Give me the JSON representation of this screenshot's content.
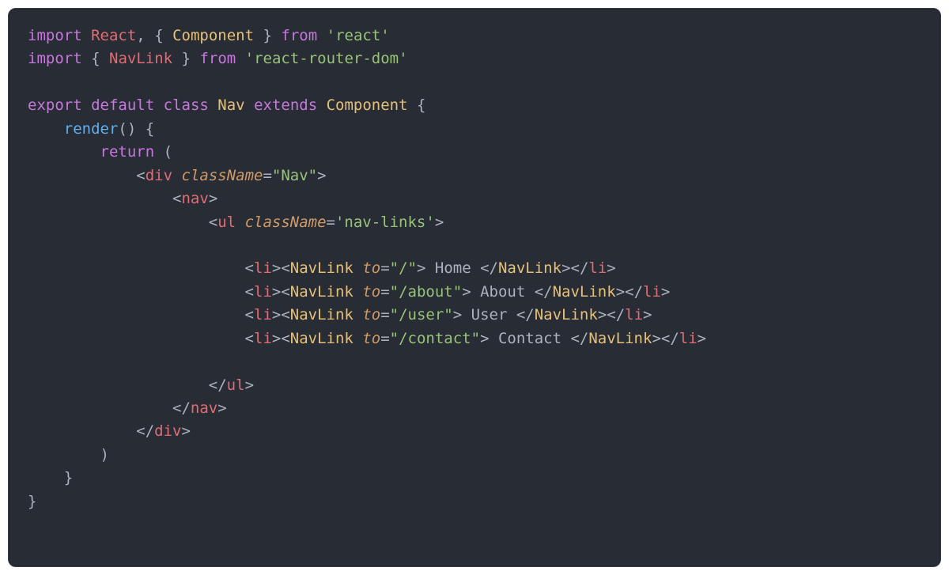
{
  "code": {
    "line1": {
      "import": "import",
      "react": "React",
      "comma": ",",
      "lbrace": "{",
      "component": "Component",
      "rbrace": "}",
      "from": "from",
      "pkg": "'react'"
    },
    "line2": {
      "import": "import",
      "lbrace": "{",
      "navlink": "NavLink",
      "rbrace": "}",
      "from": "from",
      "pkg": "'react-router-dom'"
    },
    "line4": {
      "export": "export",
      "default": "default",
      "class": "class",
      "name": "Nav",
      "extends": "extends",
      "base": "Component",
      "lbrace": "{"
    },
    "line5": {
      "render": "render",
      "parens": "()",
      "lbrace": "{"
    },
    "line6": {
      "return": "return",
      "lparen": "("
    },
    "line7": {
      "lt": "<",
      "tag": "div",
      "sp": " ",
      "attr": "className",
      "eq": "=",
      "val": "\"Nav\"",
      "gt": ">"
    },
    "line8": {
      "lt": "<",
      "tag": "nav",
      "gt": ">"
    },
    "line9": {
      "lt": "<",
      "tag": "ul",
      "sp": " ",
      "attr": "className",
      "eq": "=",
      "val": "'nav-links'",
      "gt": ">"
    },
    "link1": {
      "li_open_lt": "<",
      "li": "li",
      "li_open_gt": ">",
      "nl_open_lt": "<",
      "nl": "NavLink",
      "sp": " ",
      "attr": "to",
      "eq": "=",
      "val": "\"/\"",
      "nl_open_gt": ">",
      "text": " Home ",
      "nl_close": "</",
      "nl2": "NavLink",
      "nl_close_gt": ">",
      "li_close": "</",
      "li2": "li",
      "li_close_gt": ">"
    },
    "link2": {
      "li_open_lt": "<",
      "li": "li",
      "li_open_gt": ">",
      "nl_open_lt": "<",
      "nl": "NavLink",
      "sp": " ",
      "attr": "to",
      "eq": "=",
      "val": "\"/about\"",
      "nl_open_gt": ">",
      "text": " About ",
      "nl_close": "</",
      "nl2": "NavLink",
      "nl_close_gt": ">",
      "li_close": "</",
      "li2": "li",
      "li_close_gt": ">"
    },
    "link3": {
      "li_open_lt": "<",
      "li": "li",
      "li_open_gt": ">",
      "nl_open_lt": "<",
      "nl": "NavLink",
      "sp": " ",
      "attr": "to",
      "eq": "=",
      "val": "\"/user\"",
      "nl_open_gt": ">",
      "text": " User ",
      "nl_close": "</",
      "nl2": "NavLink",
      "nl_close_gt": ">",
      "li_close": "</",
      "li2": "li",
      "li_close_gt": ">"
    },
    "link4": {
      "li_open_lt": "<",
      "li": "li",
      "li_open_gt": ">",
      "nl_open_lt": "<",
      "nl": "NavLink",
      "sp": " ",
      "attr": "to",
      "eq": "=",
      "val": "\"/contact\"",
      "nl_open_gt": ">",
      "text": " Contact ",
      "nl_close": "</",
      "nl2": "NavLink",
      "nl_close_gt": ">",
      "li_close": "</",
      "li2": "li",
      "li_close_gt": ">"
    },
    "close_ul": {
      "lt": "</",
      "tag": "ul",
      "gt": ">"
    },
    "close_nav": {
      "lt": "</",
      "tag": "nav",
      "gt": ">"
    },
    "close_div": {
      "lt": "</",
      "tag": "div",
      "gt": ">"
    },
    "line_rparen": ")",
    "line_rbrace1": "}",
    "line_rbrace2": "}"
  }
}
